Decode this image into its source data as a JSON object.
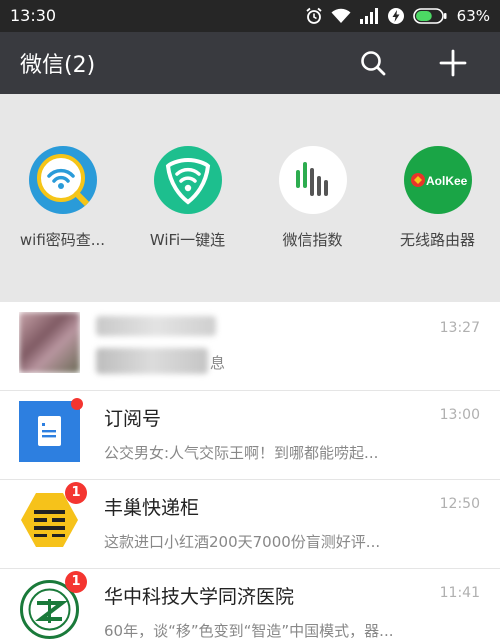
{
  "status_bar": {
    "time": "13:30",
    "battery": "63%",
    "battery_fill": 0.63,
    "icons": [
      "alarm-icon",
      "wifi-icon",
      "signal-icon",
      "charging-icon",
      "battery-icon"
    ]
  },
  "header": {
    "title": "微信(2)",
    "search_icon": "search-icon",
    "add_icon": "plus-icon"
  },
  "mini_apps": [
    {
      "label": "wifi密码查...",
      "icon": "wifi-magnifier-icon",
      "color": "#2a9bd9"
    },
    {
      "label": "WiFi一键连",
      "icon": "wifi-shield-icon",
      "color": "#1dbf8e"
    },
    {
      "label": "微信指数",
      "icon": "index-bars-icon",
      "color": "#2dac4f"
    },
    {
      "label": "无线路由器",
      "icon": "aolkee-logo-icon",
      "color": "#1aa546",
      "logo_text": "AolKee"
    }
  ],
  "chats": [
    {
      "name": "",
      "preview": "息",
      "time": "13:27",
      "blurred": true,
      "badge": ""
    },
    {
      "name": "订阅号",
      "preview": "公交男女:人气交际王啊！到哪都能唠起...",
      "time": "13:00",
      "badge": "",
      "dot": true
    },
    {
      "name": "丰巢快递柜",
      "preview": "这款进口小红酒200天7000份盲测好评...",
      "time": "12:50",
      "badge": "1"
    },
    {
      "name": "华中科技大学同济医院",
      "preview": "60年，谈“移”色变到“智造”中国模式，器...",
      "time": "11:41",
      "badge": "1"
    }
  ],
  "colors": {
    "header_bg": "#393a3f",
    "status_bg": "#262626",
    "panel_bg": "#e7e7e7",
    "badge": "#f43530",
    "subscription_blue": "#2d7fe0",
    "fengchao_yellow": "#f6c21a",
    "hospital_green": "#1a7a3a"
  }
}
